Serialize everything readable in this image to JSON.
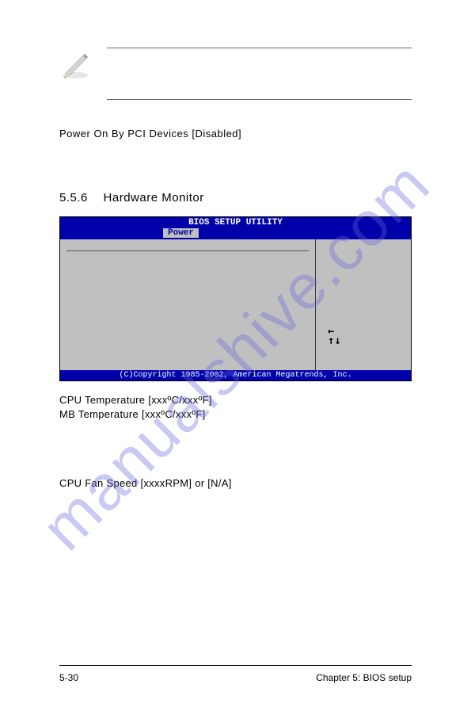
{
  "watermark": "manualshive.com",
  "setting": {
    "label": "Power On By PCI Devices",
    "value": "[Disabled]"
  },
  "section": {
    "number": "5.5.6",
    "title": "Hardware Monitor"
  },
  "bios": {
    "title": "BIOS SETUP UTILITY",
    "tab": "Power",
    "nav_symbol": "↑↓",
    "nav_left": "←",
    "copyright": "(C)Copyright 1985-2002, American Megatrends, Inc."
  },
  "temps": {
    "cpu": "CPU Temperature [xxxºC/xxxºF]",
    "mb": "MB Temperature [xxxºC/xxxºF]"
  },
  "fan": "CPU Fan Speed [xxxxRPM] or [N/A]",
  "footer": {
    "left": "5-30",
    "right": "Chapter 5: BIOS setup"
  }
}
